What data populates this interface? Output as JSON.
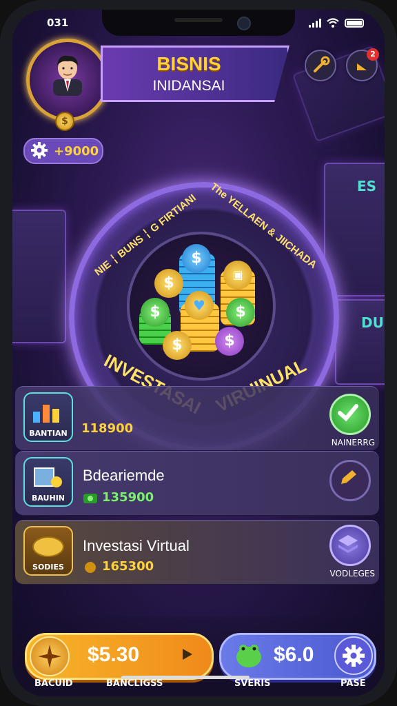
{
  "status": {
    "time": "031"
  },
  "header": {
    "title_line1": "BISNIS",
    "title_line2": "INIDANSAI"
  },
  "currency": {
    "value": "+9000"
  },
  "wheel": {
    "top_left_text": "NIE ╎ BUNS ╎ G FIRTIANI",
    "top_right_text": "The YELLAEN & JIICHADA",
    "bottom_left_text": "INVESTASAI",
    "bottom_right_text": "VIRUINUAL"
  },
  "rows": [
    {
      "icon_label": "BANTIAN",
      "title": "",
      "value": "118900",
      "action_label": "NAINERRG"
    },
    {
      "icon_label": "BAUHIN",
      "title": "Bdeariemde",
      "value": "135900",
      "action_label": ""
    },
    {
      "icon_label": "SODIES",
      "title": "Investasi Virtual",
      "value": "165300",
      "action_label": "VODLEGES"
    }
  ],
  "bottom": {
    "left_price": "$5.30",
    "right_price": "$6.0",
    "labels": [
      "BACUID",
      "BANCLIGSS",
      "SVERIS",
      "PASE"
    ]
  },
  "icons": {
    "settings": "gear-icon",
    "tool": "wrench-icon",
    "notification": "bell-icon",
    "check": "check-icon",
    "edit": "pencil-icon",
    "layers": "layers-icon",
    "play": "play-icon",
    "compass": "compass-icon",
    "pet": "frog-icon"
  },
  "colors": {
    "gold": "#ffd23a",
    "green": "#4ad04a",
    "orange": "#f7b52a",
    "purple": "#6a4ab8"
  }
}
